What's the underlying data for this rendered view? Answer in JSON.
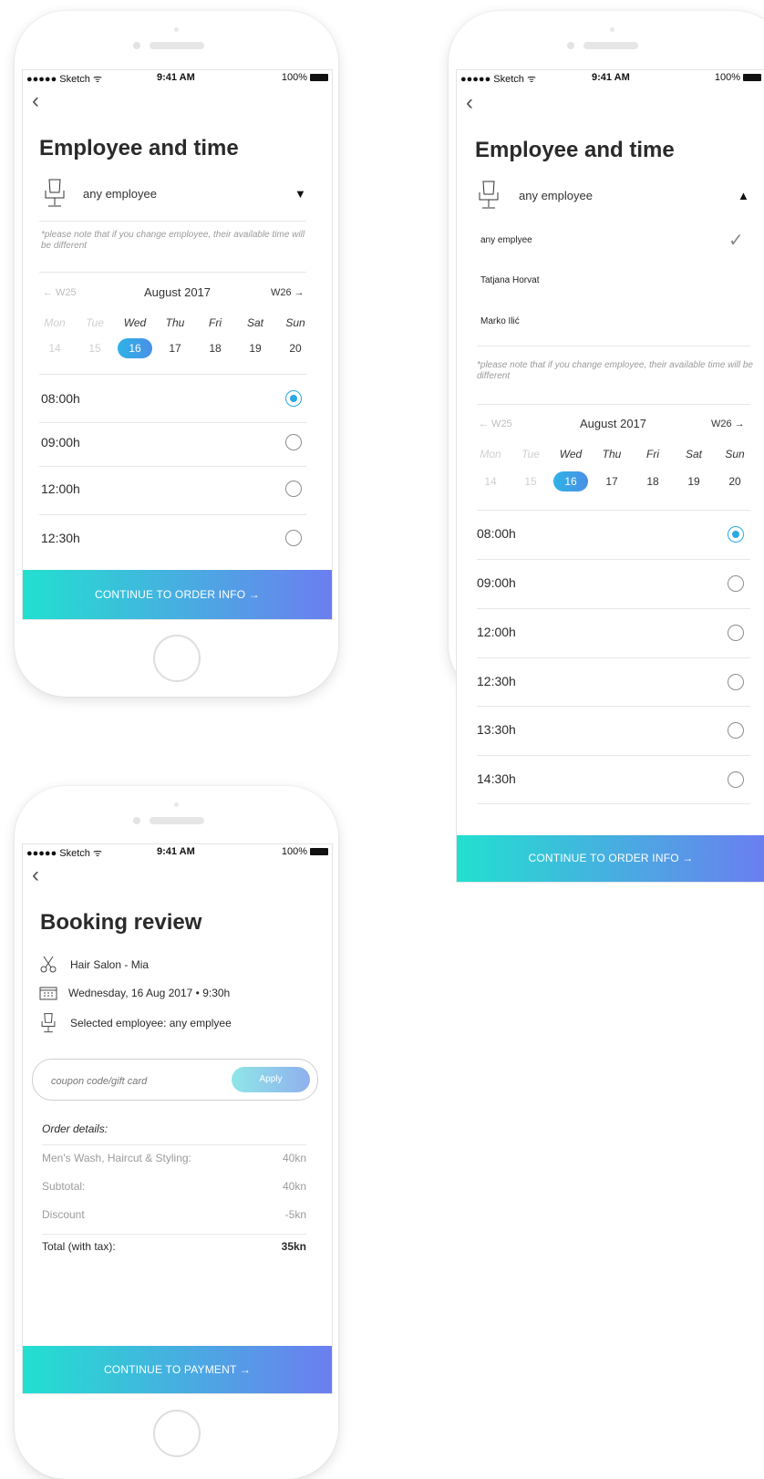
{
  "status_bar": {
    "carrier": "●●●●● Sketch",
    "wifi": "ᯤ",
    "time": "9:41 AM",
    "battery": "100%"
  },
  "screen1": {
    "back": "‹",
    "title": "Employee and time",
    "employee": "any employee",
    "caret": "▼",
    "note": "*please note that if you change employee, their available time will be different",
    "prev_week": "← W25",
    "month": "August 2017",
    "next_week": "W26 →",
    "days": [
      {
        "dow": "Mon",
        "num": "14"
      },
      {
        "dow": "Tue",
        "num": "15"
      },
      {
        "dow": "Wed",
        "num": "16"
      },
      {
        "dow": "Thu",
        "num": "17"
      },
      {
        "dow": "Fri",
        "num": "18"
      },
      {
        "dow": "Sat",
        "num": "19"
      },
      {
        "dow": "Sun",
        "num": "20"
      }
    ],
    "slots": [
      "08:00h",
      "09:00h",
      "12:00h",
      "12:30h"
    ],
    "cta": "CONTINUE TO ORDER INFO →"
  },
  "screen2": {
    "back": "‹",
    "title": "Employee and time",
    "employee": "any employee",
    "caret": "▲",
    "options": [
      "any emplyee",
      "Tatjana Horvat",
      "Marko Ilić"
    ],
    "check": "✓",
    "note": "*please note that if you change employee, their available time will be different",
    "prev_week": "← W25",
    "month": "August 2017",
    "next_week": "W26 →",
    "days": [
      {
        "dow": "Mon",
        "num": "14"
      },
      {
        "dow": "Tue",
        "num": "15"
      },
      {
        "dow": "Wed",
        "num": "16"
      },
      {
        "dow": "Thu",
        "num": "17"
      },
      {
        "dow": "Fri",
        "num": "18"
      },
      {
        "dow": "Sat",
        "num": "19"
      },
      {
        "dow": "Sun",
        "num": "20"
      }
    ],
    "slots": [
      "08:00h",
      "09:00h",
      "12:00h",
      "12:30h",
      "13:30h",
      "14:30h"
    ],
    "cta": "CONTINUE TO ORDER INFO →"
  },
  "screen3": {
    "back": "‹",
    "title": "Booking review",
    "salon": "Hair Salon - Mia",
    "datetime": "Wednesday, 16 Aug 2017 • 9:30h",
    "employee": "Selected employee: any emplyee",
    "coupon_placeholder": "coupon code/gift card",
    "apply": "Apply",
    "order_details": "Order details:",
    "lines": [
      {
        "label": "Men's Wash, Haircut & Styling:",
        "value": "40kn"
      },
      {
        "label": "Subtotal:",
        "value": "40kn"
      },
      {
        "label": "Discount",
        "value": "-5kn"
      }
    ],
    "total_label": "Total (with tax):",
    "total_value": "35kn",
    "cta": "CONTINUE TO PAYMENT →"
  },
  "colors": {
    "accent": "#2aa9e3",
    "cta_start": "#22e0d0",
    "cta_end": "#6b7ef0"
  },
  "icons": {
    "chair": "chair-icon",
    "scissors": "scissors-icon",
    "calendar": "calendar-icon",
    "check": "check-icon",
    "back": "back-arrow-icon"
  }
}
